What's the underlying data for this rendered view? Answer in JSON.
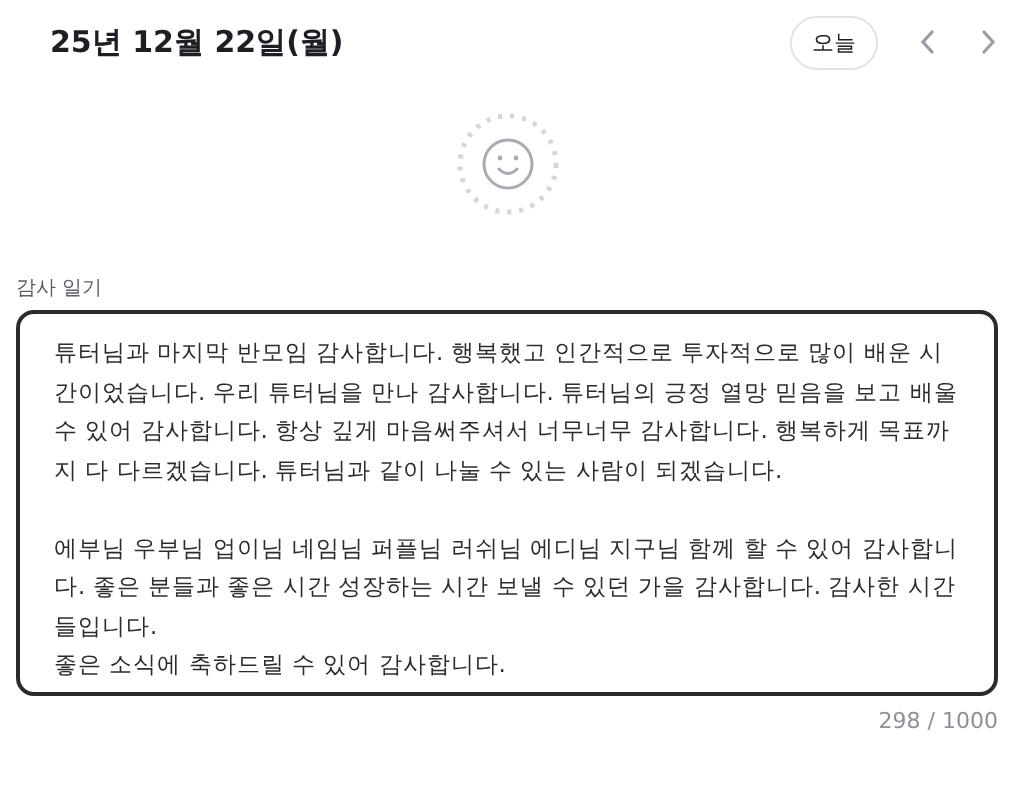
{
  "header": {
    "date": "25년 12월 22일(월)",
    "today_button": "오늘"
  },
  "diary": {
    "label": "감사 일기",
    "value": "튜터님과 마지막 반모임 감사합니다. 행복했고 인간적으로 투자적으로 많이 배운 시간이었습니다. 우리 튜터님을 만나 감사합니다. 튜터님의 긍정 열망 믿음을 보고 배울 수 있어 감사합니다. 항상 깊게 마음써주셔서 너무너무 감사합니다. 행복하게 목표까지 다 다르겠습니다. 튜터님과 같이 나눌 수 있는 사람이 되겠습니다.\n\n에부님 우부님 업이님 네임님 퍼플님 러쉬님 에디님 지구님 함께 할 수 있어 감사합니다. 좋은 분들과 좋은 시간 성장하는 시간 보낼 수 있던 가을 감사합니다. 감사한 시간들입니다.\n좋은 소식에 축하드릴 수 있어 감사합니다.",
    "counter": "298 / 1000"
  }
}
